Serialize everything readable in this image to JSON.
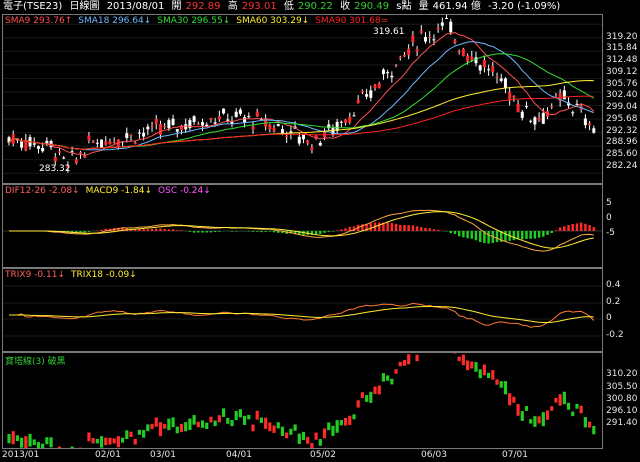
{
  "header": {
    "symbol": "電子(TSE23)",
    "period": "日線圖",
    "date": "2013/08/01",
    "open_label": "開",
    "open": "292.89",
    "high_label": "高",
    "high": "293.01",
    "low_label": "低",
    "low": "290.22",
    "close_label": "收",
    "close": "290.49",
    "unit": "s點",
    "volume_label": "量",
    "volume": "461.94 億",
    "change": "-3.20 (-1.09%)"
  },
  "panels": {
    "price": {
      "legend": [
        {
          "label": "SMA9 293.76↑",
          "color": "#ff5050"
        },
        {
          "label": "SMA18 296.64↓",
          "color": "#6fb7ff"
        },
        {
          "label": "SMA30 296.55↓",
          "color": "#33dd33"
        },
        {
          "label": "SMA60 303.29↓",
          "color": "#ffee33"
        },
        {
          "label": "SMA90 301.68=",
          "color": "#ff2222"
        }
      ],
      "high_mark": "319.61",
      "low_mark": "283.32",
      "axis": [
        "319.20",
        "315.84",
        "312.48",
        "309.12",
        "305.76",
        "302.40",
        "299.04",
        "295.68",
        "292.32",
        "288.96",
        "285.60",
        "282.24"
      ]
    },
    "macd": {
      "legend": [
        {
          "label": "DIF12-26 -2.08↓",
          "color": "#ff6060"
        },
        {
          "label": "MACD9 -1.84↓",
          "color": "#ffee33"
        },
        {
          "label": "OSC -0.24↓",
          "color": "#ff55ff"
        }
      ],
      "axis": [
        "5",
        "0",
        "-5"
      ]
    },
    "trix": {
      "legend": [
        {
          "label": "TRIX9 -0.11↓",
          "color": "#ff6060"
        },
        {
          "label": "TRIX18 -0.09↓",
          "color": "#ffee33"
        }
      ],
      "axis": [
        "0.4",
        "0.2",
        "0",
        "-0.2"
      ]
    },
    "swing": {
      "legend": [
        {
          "label": "寶塔線(3) 破黑",
          "color": "#33cc33"
        }
      ],
      "axis": [
        "310.20",
        "305.50",
        "300.80",
        "296.10",
        "291.40"
      ]
    }
  },
  "dates": [
    "2013/01",
    "02/01",
    "03/01",
    "04/01",
    "05/02",
    "06/03",
    "07/01"
  ],
  "colors": {
    "up": "#ff2a2a",
    "down": "#22cc22",
    "sma9": "#ff5050",
    "sma18": "#6fb7ff",
    "sma30": "#33dd33",
    "sma60": "#ffee33",
    "sma90": "#ff2222"
  }
}
